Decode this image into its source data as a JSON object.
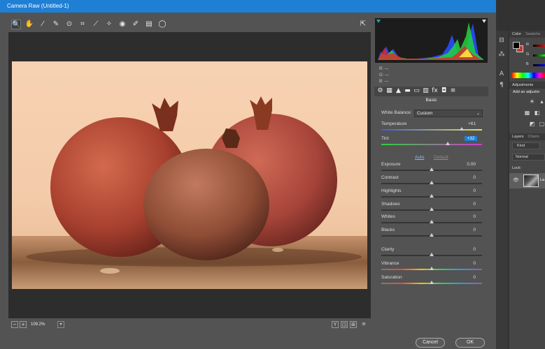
{
  "window": {
    "title": "Camera Raw (Untitled-1)"
  },
  "toolbar": {
    "tools": [
      {
        "name": "zoom-tool-icon",
        "glyph": "🔍"
      },
      {
        "name": "hand-tool-icon",
        "glyph": "✋"
      },
      {
        "name": "white-balance-tool-icon",
        "glyph": "⁄"
      },
      {
        "name": "color-sampler-tool-icon",
        "glyph": "✎"
      },
      {
        "name": "targeted-adjustment-tool-icon",
        "glyph": "⊙"
      },
      {
        "name": "crop-tool-icon",
        "glyph": "⌗"
      },
      {
        "name": "straighten-tool-icon",
        "glyph": "⟋"
      },
      {
        "name": "spot-removal-tool-icon",
        "glyph": "✧"
      },
      {
        "name": "red-eye-tool-icon",
        "glyph": "◉"
      },
      {
        "name": "adjustment-brush-icon",
        "glyph": "✐"
      },
      {
        "name": "graduated-filter-icon",
        "glyph": "▤"
      },
      {
        "name": "radial-filter-icon",
        "glyph": "◯"
      }
    ],
    "right_icon": {
      "name": "open-preferences-icon",
      "glyph": "⇱"
    }
  },
  "status": {
    "zoom": "109.2%"
  },
  "histogram": {
    "readout": {
      "r": "R:  ---",
      "g": "G:  ---",
      "b": "B:  ---"
    }
  },
  "panel": {
    "title": "Basic",
    "tabs": [
      "⚙",
      "▦",
      "▲",
      "▬",
      "▭",
      "▥",
      "fx",
      "◘",
      "≡"
    ],
    "white_balance": {
      "label": "White Balance:",
      "value": "Custom"
    },
    "auto_label": "Auto",
    "default_label": "Default",
    "sliders": [
      {
        "key": "temperature",
        "label": "Temperature",
        "value": "+61",
        "pos": 0.8,
        "highlight": false,
        "track": "temp"
      },
      {
        "key": "tint",
        "label": "Tint",
        "value": "+32",
        "pos": 0.66,
        "highlight": true,
        "track": "tint"
      },
      {
        "key": "exposure",
        "label": "Exposure",
        "value": "0.00",
        "pos": 0.5,
        "highlight": false,
        "track": "plain"
      },
      {
        "key": "contrast",
        "label": "Contrast",
        "value": "0",
        "pos": 0.5,
        "highlight": false,
        "track": "plain"
      },
      {
        "key": "highlights",
        "label": "Highlights",
        "value": "0",
        "pos": 0.5,
        "highlight": false,
        "track": "plain"
      },
      {
        "key": "shadows",
        "label": "Shadows",
        "value": "0",
        "pos": 0.5,
        "highlight": false,
        "track": "plain"
      },
      {
        "key": "whites",
        "label": "Whites",
        "value": "0",
        "pos": 0.5,
        "highlight": false,
        "track": "plain"
      },
      {
        "key": "blacks",
        "label": "Blacks",
        "value": "0",
        "pos": 0.5,
        "highlight": false,
        "track": "plain"
      },
      {
        "key": "clarity",
        "label": "Clarity",
        "value": "0",
        "pos": 0.5,
        "highlight": false,
        "track": "plain"
      },
      {
        "key": "vibrance",
        "label": "Vibrance",
        "value": "0",
        "pos": 0.5,
        "highlight": false,
        "track": "sat"
      },
      {
        "key": "saturation",
        "label": "Saturation",
        "value": "0",
        "pos": 0.5,
        "highlight": false,
        "track": "sat"
      }
    ]
  },
  "buttons": {
    "cancel": "Cancel",
    "ok": "OK"
  },
  "photoshop": {
    "color_tab": "Color",
    "swatches_tab": "Swatche",
    "rgb": [
      "R",
      "G",
      "B"
    ],
    "adjustments_tab": "Adjustments",
    "adjustments_title": "Add an adjustm",
    "layers_tab": "Layers",
    "channels_tab": "Chann",
    "kind": "Kind",
    "blend_mode": "Normal",
    "lock_label": "Lock:",
    "layer_name": "La"
  },
  "colors": {
    "accent": "#1f7fd4",
    "dialog_bg": "#535353",
    "canvas_bg": "#2d2d2d"
  }
}
